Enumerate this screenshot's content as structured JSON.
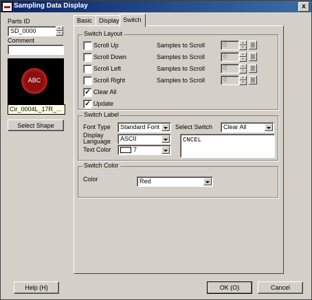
{
  "window": {
    "title": "Sampling Data Display",
    "close_label": "x"
  },
  "left": {
    "parts_id_label": "Parts ID",
    "parts_id_value": "SD_0000",
    "comment_label": "Comment",
    "comment_value": "",
    "preview_text": "ABC",
    "shape_name": "Cir_0004L_17R_...",
    "select_shape_label": "Select Shape"
  },
  "tabs": [
    {
      "label": "Basic"
    },
    {
      "label": "Display"
    },
    {
      "label": "Switch"
    }
  ],
  "switch_layout": {
    "title": "Switch Layout",
    "items": [
      {
        "label": "Scroll Up",
        "checked": false,
        "samples_label": "Samples to Scroll",
        "value": "0"
      },
      {
        "label": "Scroll Down",
        "checked": false,
        "samples_label": "Samples to Scroll",
        "value": "0"
      },
      {
        "label": "Scroll Left",
        "checked": false,
        "samples_label": "Samples to Scroll",
        "value": "0"
      },
      {
        "label": "Scroll Right",
        "checked": false,
        "samples_label": "Samples to Scroll",
        "value": "0"
      },
      {
        "label": "Clear All",
        "checked": true
      },
      {
        "label": "Update",
        "checked": true
      }
    ]
  },
  "switch_label": {
    "title": "Switch Label",
    "font_type_label": "Font Type",
    "font_type_value": "Standard Font",
    "display_language_label_1": "Display",
    "display_language_label_2": "Language",
    "display_language_value": "ASCII",
    "text_color_label": "Text Color",
    "text_color_value": "7",
    "select_switch_label": "Select Switch",
    "select_switch_value": "Clear All",
    "label_text": "CNCEL"
  },
  "switch_color": {
    "title": "Switch Color",
    "color_label": "Color",
    "color_value": "Red"
  },
  "footer": {
    "help_label": "Help (H)",
    "ok_label": "OK (O)",
    "cancel_label": "Cancel"
  }
}
